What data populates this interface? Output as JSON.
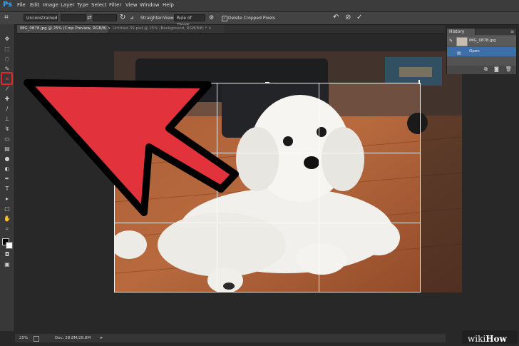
{
  "app": {
    "logo": "Ps"
  },
  "menu": [
    "File",
    "Edit",
    "Image",
    "Layer",
    "Type",
    "Select",
    "Filter",
    "View",
    "Window",
    "Help"
  ],
  "options": {
    "ratio": "Unconstrained",
    "straighten_label": "Straighten",
    "view_label": "View:",
    "view_value": "Rule of Thirds",
    "delete_cropped_label": "Delete Cropped Pixels",
    "icons": {
      "crop_tool": "crop-icon",
      "swap": "swap-icon",
      "reset": "undo-icon",
      "cancel": "cancel-icon",
      "commit": "check-icon"
    }
  },
  "tabs": [
    {
      "label": "IMG_0878.jpg @ 25% (Crop Preview, RGB/8) ×"
    },
    {
      "label": "Untitled-39.psd @ 25% (Background, RGB/8#) * ×"
    }
  ],
  "history": {
    "title": "History",
    "items": [
      {
        "label": "IMG_0878.jpg"
      },
      {
        "label": "Open"
      }
    ]
  },
  "status": {
    "zoom": "25%",
    "doc": "Doc: 28.8M/28.8M"
  },
  "colors": {
    "highlight": "#e2262f",
    "arrow": "#e2333d"
  },
  "watermark": {
    "wiki": "wiki",
    "how": "How"
  }
}
